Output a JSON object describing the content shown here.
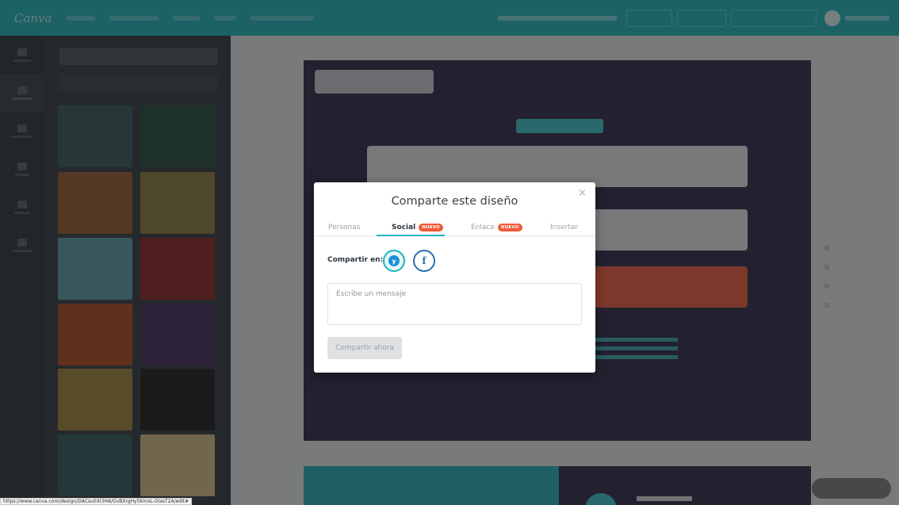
{
  "modal": {
    "title": "Comparte este diseño",
    "close_glyph": "×",
    "tabs": [
      {
        "label": "Personas",
        "badge": ""
      },
      {
        "label": "Social",
        "badge": "NUEVO"
      },
      {
        "label": "Enlace",
        "badge": "NUEVO"
      },
      {
        "label": "Insertar",
        "badge": ""
      }
    ],
    "active_tab": "Social",
    "share_label": "Compartir en:",
    "social": [
      {
        "name": "twitter",
        "icon": "twitter-icon",
        "glyph": "y"
      },
      {
        "name": "facebook",
        "icon": "facebook-icon",
        "glyph": "f"
      }
    ],
    "message_placeholder": "Escribe un mensaje",
    "share_button": "Compartir ahora"
  },
  "status_bar": {
    "url": "https://www.canva.com/design/DACsu0XI3HA/GvBXrgHy5kInoL-OlasT2A/edit#"
  },
  "colors": {
    "accent": "#1bb6bd",
    "badge": "#f05a3b",
    "design_bg": "#2c2446"
  }
}
